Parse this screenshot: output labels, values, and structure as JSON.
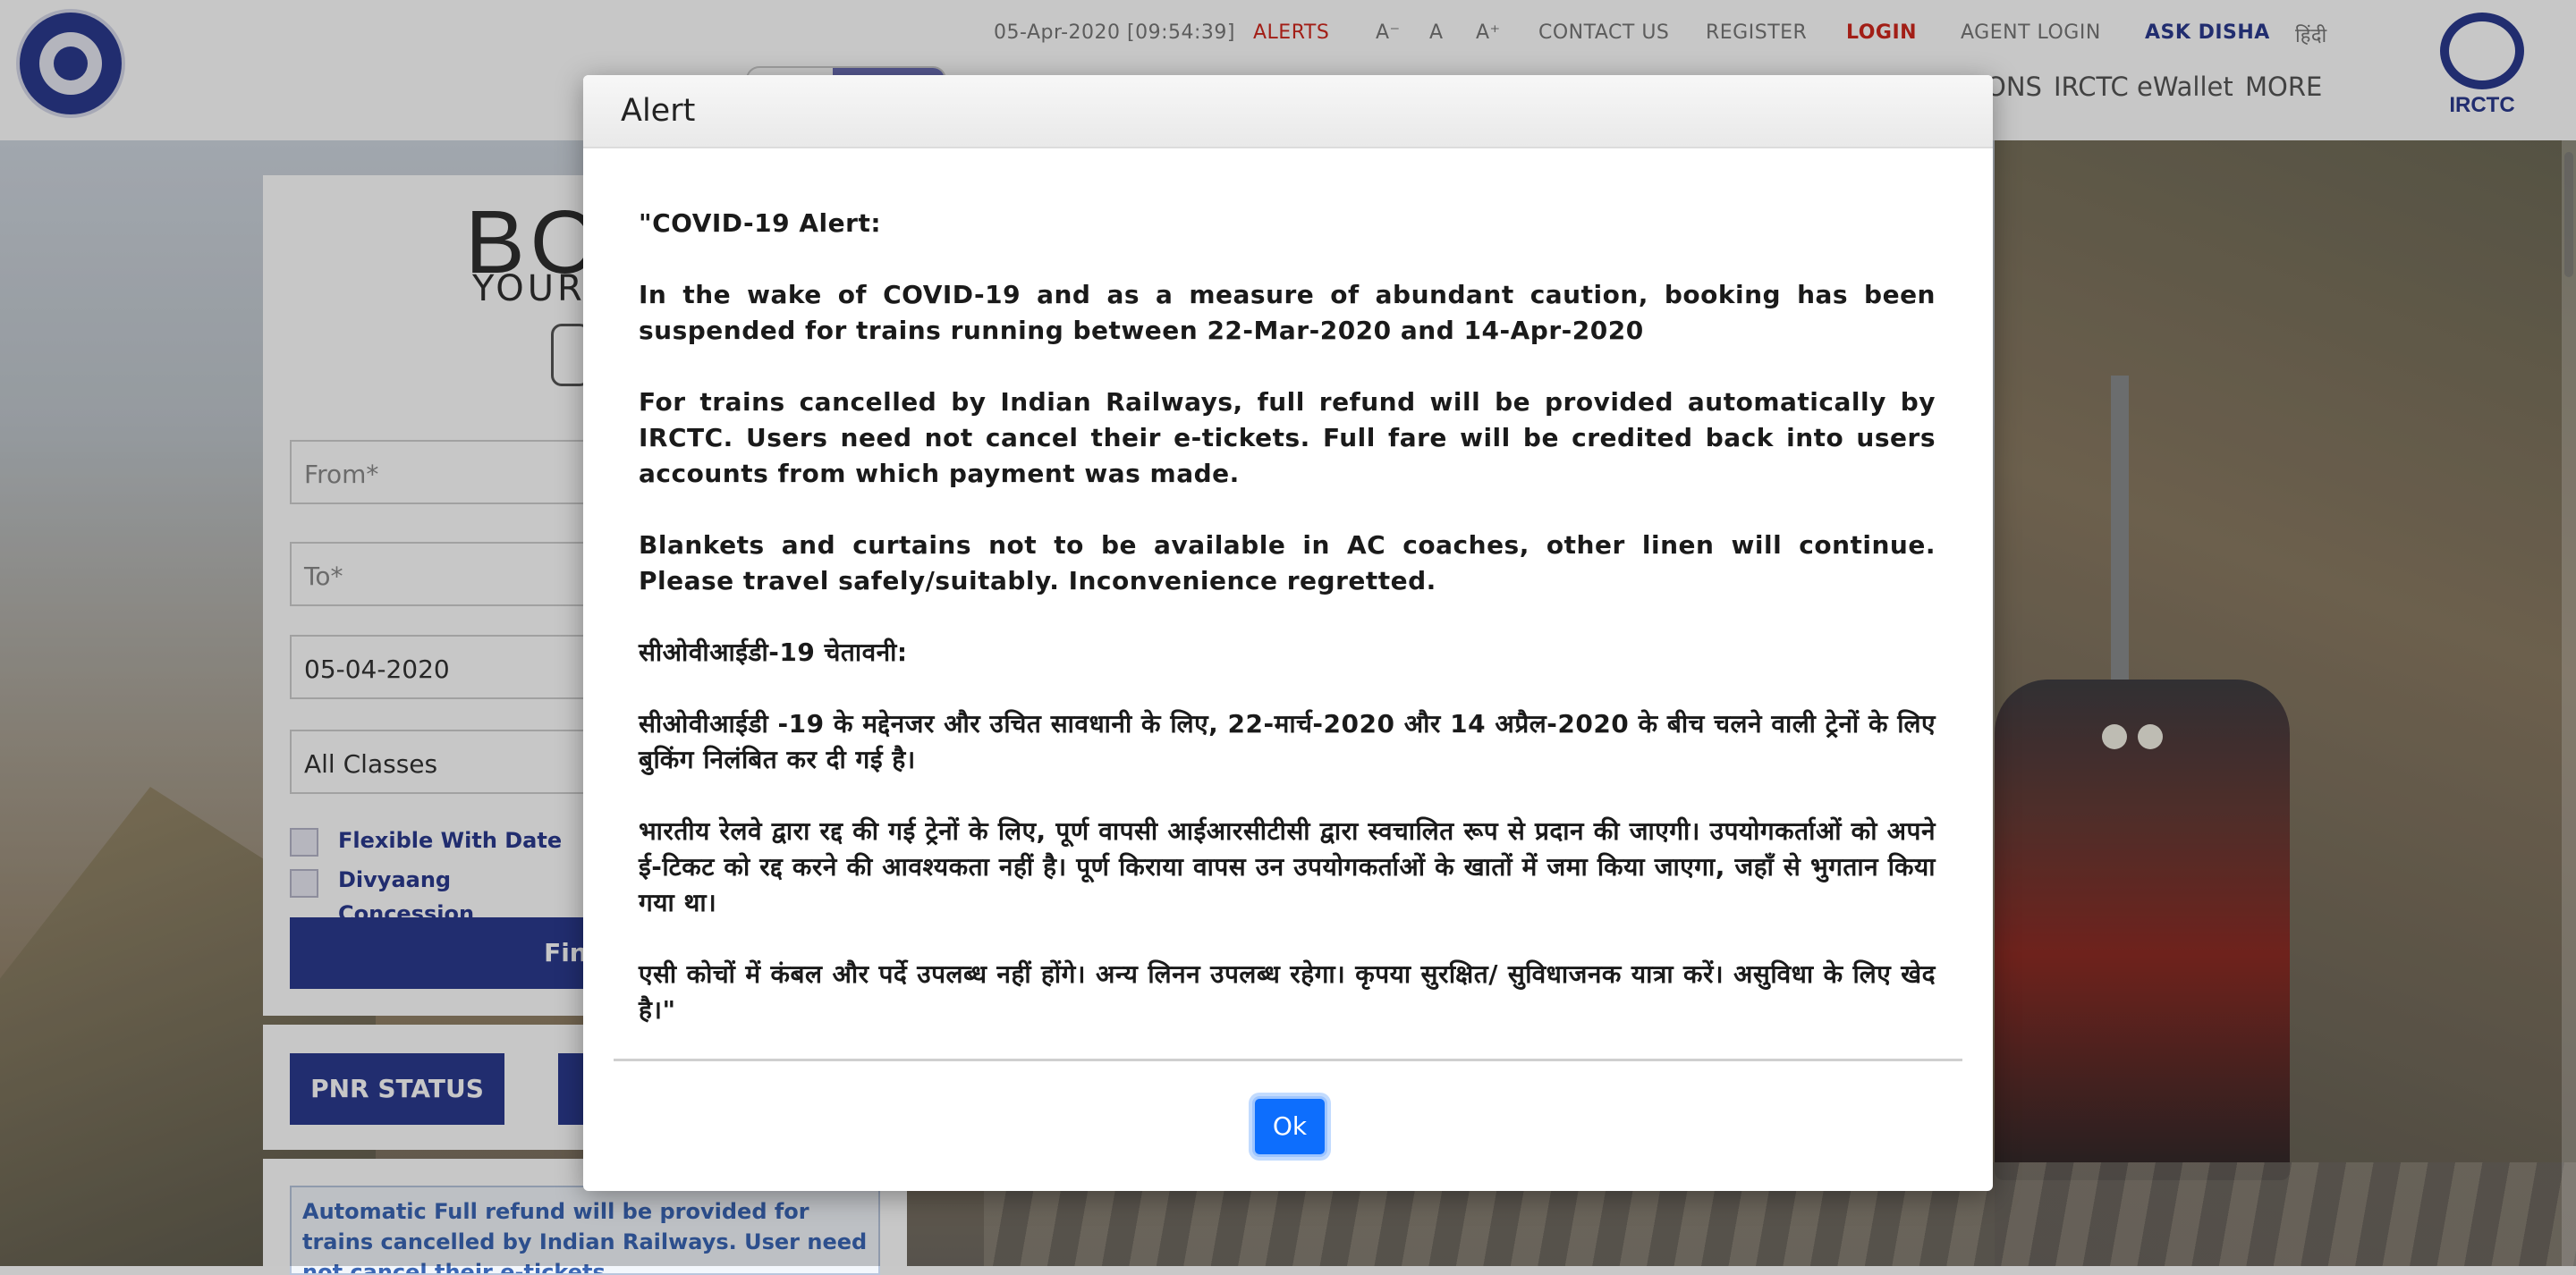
{
  "header": {
    "datetime": "05-Apr-2020 [09:54:39]",
    "alerts": "ALERTS",
    "font_small": "A⁻",
    "font_normal": "A",
    "font_large": "A⁺",
    "contact": "CONTACT US",
    "register": "REGISTER",
    "login": "LOGIN",
    "agent_login": "AGENT LOGIN",
    "ask_disha": "ASK DISHA",
    "hindi": "हिंदी",
    "main_nav": [
      "ONS",
      "IRCTC eWallet",
      "MORE"
    ],
    "brand_logo_text": "IRCTC",
    "rail_logo_icon": "indian-railways-emblem-icon"
  },
  "booking": {
    "title": "BO",
    "subtitle": "YOUR",
    "from_placeholder": "From*",
    "to_placeholder": "To*",
    "date_value": "05-04-2020",
    "class_value": "All Classes",
    "flexible_label": "Flexible With Date",
    "divyaang_label": "Divyaang",
    "concession_label": "Concession",
    "find_label": "Find t",
    "pnr_label": "PNR STATUS",
    "notice_text": "Automatic Full refund will be provided for trains cancelled by Indian Railways. User need not cancel their e-tickets."
  },
  "modal": {
    "title": "Alert",
    "paragraphs": [
      "\"COVID-19 Alert:",
      "In the wake of COVID-19 and as a measure of abundant caution, booking has been suspended for trains running between 22-Mar-2020 and 14-Apr-2020",
      "For trains cancelled by Indian Railways, full refund will be provided automatically by IRCTC. Users need not cancel their e-tickets. Full fare will be credited back into users accounts from which payment was made.",
      "Blankets and curtains not to be available in AC coaches, other linen will continue. Please travel safely/suitably. Inconvenience regretted.",
      "सीओवीआईडी-19 चेतावनी:",
      "सीओवीआईडी -19 के मद्देनजर और उचित सावधानी के लिए, 22-मार्च-2020 और 14 अप्रैल-2020 के बीच चलने वाली ट्रेनों के लिए बुकिंग निलंबित कर दी गई है।",
      "भारतीय रेलवे द्वारा रद्द की गई ट्रेनों के लिए, पूर्ण वापसी आईआरसीटीसी द्वारा स्वचालित रूप से प्रदान की जाएगी। उपयोगकर्ताओं को अपने ई-टिकट को रद्द करने की आवश्यकता नहीं है। पूर्ण किराया वापस उन उपयोगकर्ताओं के खातों में जमा किया जाएगा, जहाँ से भुगतान किया गया था।",
      "एसी कोचों में कंबल और पर्दे उपलब्ध नहीं होंगे। अन्य लिनन उपलब्ध रहेगा। कृपया सुरक्षित/ सुविधाजनक यात्रा करें। असुविधा के लिए खेद है।\""
    ],
    "ok_label": "Ok"
  },
  "colors": {
    "brand": "#2b3a8f",
    "alert_red": "#d0271d",
    "ok_blue": "#0d6efd"
  }
}
